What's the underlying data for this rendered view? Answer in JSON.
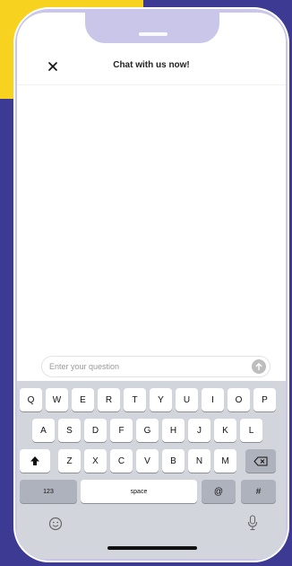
{
  "header": {
    "title": "Chat with us now!",
    "close_icon": "close-icon"
  },
  "input": {
    "placeholder": "Enter your question",
    "send_icon": "send-arrow-icon"
  },
  "keyboard": {
    "row1": [
      "Q",
      "W",
      "E",
      "R",
      "T",
      "Y",
      "U",
      "I",
      "O",
      "P"
    ],
    "row2": [
      "A",
      "S",
      "D",
      "F",
      "G",
      "H",
      "J",
      "K",
      "L"
    ],
    "row3": [
      "Z",
      "X",
      "C",
      "V",
      "B",
      "N",
      "M"
    ],
    "shift_icon": "shift-icon",
    "backspace_icon": "backspace-icon",
    "numbers_label": "123",
    "space_label": "space",
    "at_label": "@",
    "hash_label": "#",
    "emoji_icon": "emoji-icon",
    "mic_icon": "microphone-icon"
  },
  "colors": {
    "background": "#3d3a93",
    "accent_yellow": "#f7d21e",
    "phone_frame": "#c9c6ea",
    "keyboard_bg": "#d3d5dc"
  }
}
